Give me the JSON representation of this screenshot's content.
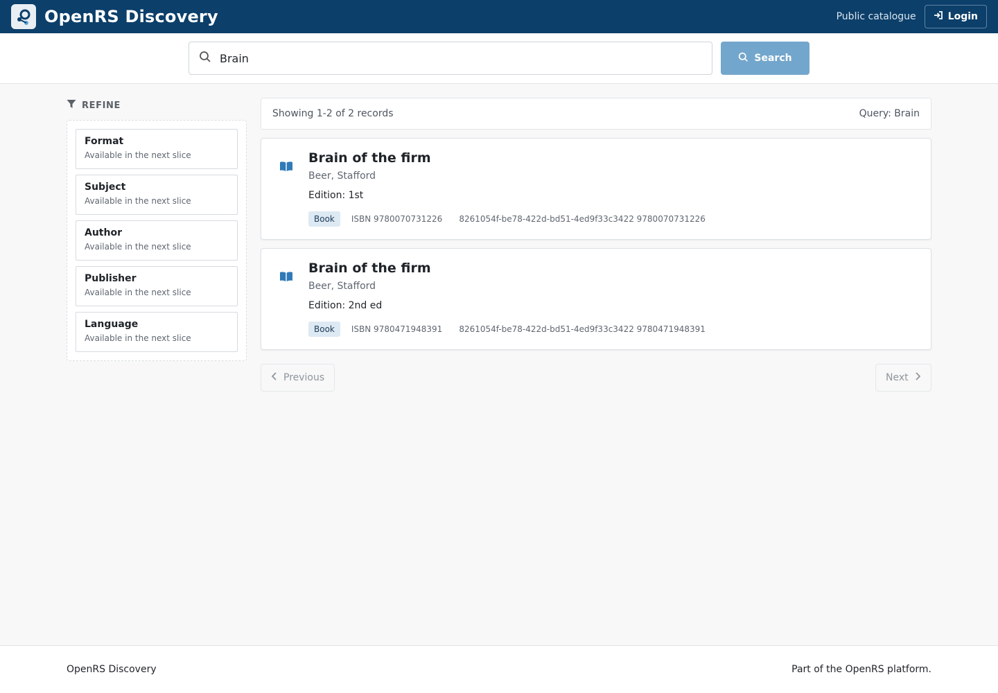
{
  "header": {
    "title": "OpenRS Discovery",
    "public_link": "Public catalogue",
    "login_label": "Login"
  },
  "search": {
    "value": "Brain",
    "button_label": "Search"
  },
  "sidebar": {
    "heading": "REFINE",
    "facets": [
      {
        "title": "Format",
        "subtitle": "Available in the next slice"
      },
      {
        "title": "Subject",
        "subtitle": "Available in the next slice"
      },
      {
        "title": "Author",
        "subtitle": "Available in the next slice"
      },
      {
        "title": "Publisher",
        "subtitle": "Available in the next slice"
      },
      {
        "title": "Language",
        "subtitle": "Available in the next slice"
      }
    ]
  },
  "results": {
    "summary": "Showing 1-2 of 2 records",
    "query": "Query: Brain",
    "records": [
      {
        "title": "Brain of the firm",
        "author": "Beer, Stafford",
        "edition": "Edition: 1st",
        "format": "Book",
        "isbn": "ISBN 9780070731226",
        "identifier": "8261054f-be78-422d-bd51-4ed9f33c3422 9780070731226"
      },
      {
        "title": "Brain of the firm",
        "author": "Beer, Stafford",
        "edition": "Edition: 2nd ed",
        "format": "Book",
        "isbn": "ISBN 9780471948391",
        "identifier": "8261054f-be78-422d-bd51-4ed9f33c3422 9780471948391"
      }
    ]
  },
  "pagination": {
    "previous_label": "Previous",
    "next_label": "Next"
  },
  "footer": {
    "left": "OpenRS Discovery",
    "right": "Part of the OpenRS platform."
  },
  "colors": {
    "header_bg": "#0c3f6a",
    "search_button": "#73a6cc",
    "book_icon": "#2f7ab8",
    "badge_bg": "#dde9f3"
  }
}
